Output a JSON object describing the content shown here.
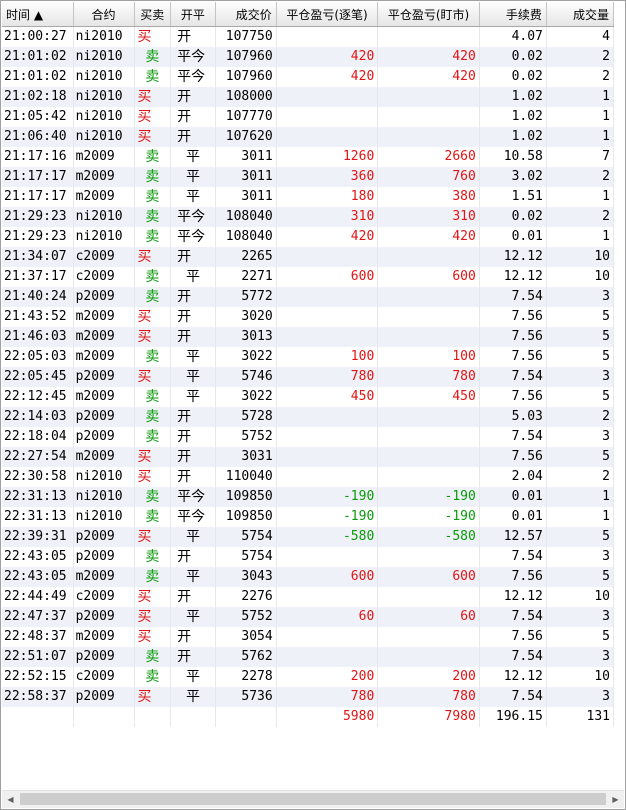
{
  "headers": {
    "time": "时间 ▲",
    "contract": "合约",
    "side": "买卖",
    "open_close": "开平",
    "price": "成交价",
    "pnl_trade": "平仓盈亏(逐笔)",
    "pnl_mark": "平仓盈亏(盯市)",
    "fee": "手续费",
    "volume": "成交量"
  },
  "rows": [
    {
      "time": "21:00:27",
      "contract": "ni2010",
      "side": "买",
      "oc": "开",
      "price": "107750",
      "pnl_trade": "",
      "pnl_mark": "",
      "fee": "4.07",
      "volume": "4"
    },
    {
      "time": "21:01:02",
      "contract": "ni2010",
      "side": "卖",
      "oc": "平今",
      "price": "107960",
      "pnl_trade": "420",
      "pnl_mark": "420",
      "fee": "0.02",
      "volume": "2"
    },
    {
      "time": "21:01:02",
      "contract": "ni2010",
      "side": "卖",
      "oc": "平今",
      "price": "107960",
      "pnl_trade": "420",
      "pnl_mark": "420",
      "fee": "0.02",
      "volume": "2"
    },
    {
      "time": "21:02:18",
      "contract": "ni2010",
      "side": "买",
      "oc": "开",
      "price": "108000",
      "pnl_trade": "",
      "pnl_mark": "",
      "fee": "1.02",
      "volume": "1"
    },
    {
      "time": "21:05:42",
      "contract": "ni2010",
      "side": "买",
      "oc": "开",
      "price": "107770",
      "pnl_trade": "",
      "pnl_mark": "",
      "fee": "1.02",
      "volume": "1"
    },
    {
      "time": "21:06:40",
      "contract": "ni2010",
      "side": "买",
      "oc": "开",
      "price": "107620",
      "pnl_trade": "",
      "pnl_mark": "",
      "fee": "1.02",
      "volume": "1"
    },
    {
      "time": "21:17:16",
      "contract": "m2009",
      "side": "卖",
      "oc": "平",
      "price": "3011",
      "pnl_trade": "1260",
      "pnl_mark": "2660",
      "fee": "10.58",
      "volume": "7"
    },
    {
      "time": "21:17:17",
      "contract": "m2009",
      "side": "卖",
      "oc": "平",
      "price": "3011",
      "pnl_trade": "360",
      "pnl_mark": "760",
      "fee": "3.02",
      "volume": "2"
    },
    {
      "time": "21:17:17",
      "contract": "m2009",
      "side": "卖",
      "oc": "平",
      "price": "3011",
      "pnl_trade": "180",
      "pnl_mark": "380",
      "fee": "1.51",
      "volume": "1"
    },
    {
      "time": "21:29:23",
      "contract": "ni2010",
      "side": "卖",
      "oc": "平今",
      "price": "108040",
      "pnl_trade": "310",
      "pnl_mark": "310",
      "fee": "0.02",
      "volume": "2"
    },
    {
      "time": "21:29:23",
      "contract": "ni2010",
      "side": "卖",
      "oc": "平今",
      "price": "108040",
      "pnl_trade": "420",
      "pnl_mark": "420",
      "fee": "0.01",
      "volume": "1"
    },
    {
      "time": "21:34:07",
      "contract": "c2009",
      "side": "买",
      "oc": "开",
      "price": "2265",
      "pnl_trade": "",
      "pnl_mark": "",
      "fee": "12.12",
      "volume": "10"
    },
    {
      "time": "21:37:17",
      "contract": "c2009",
      "side": "卖",
      "oc": "平",
      "price": "2271",
      "pnl_trade": "600",
      "pnl_mark": "600",
      "fee": "12.12",
      "volume": "10"
    },
    {
      "time": "21:40:24",
      "contract": "p2009",
      "side": "卖",
      "oc": "开",
      "price": "5772",
      "pnl_trade": "",
      "pnl_mark": "",
      "fee": "7.54",
      "volume": "3"
    },
    {
      "time": "21:43:52",
      "contract": "m2009",
      "side": "买",
      "oc": "开",
      "price": "3020",
      "pnl_trade": "",
      "pnl_mark": "",
      "fee": "7.56",
      "volume": "5"
    },
    {
      "time": "21:46:03",
      "contract": "m2009",
      "side": "买",
      "oc": "开",
      "price": "3013",
      "pnl_trade": "",
      "pnl_mark": "",
      "fee": "7.56",
      "volume": "5"
    },
    {
      "time": "22:05:03",
      "contract": "m2009",
      "side": "卖",
      "oc": "平",
      "price": "3022",
      "pnl_trade": "100",
      "pnl_mark": "100",
      "fee": "7.56",
      "volume": "5"
    },
    {
      "time": "22:05:45",
      "contract": "p2009",
      "side": "买",
      "oc": "平",
      "price": "5746",
      "pnl_trade": "780",
      "pnl_mark": "780",
      "fee": "7.54",
      "volume": "3"
    },
    {
      "time": "22:12:45",
      "contract": "m2009",
      "side": "卖",
      "oc": "平",
      "price": "3022",
      "pnl_trade": "450",
      "pnl_mark": "450",
      "fee": "7.56",
      "volume": "5"
    },
    {
      "time": "22:14:03",
      "contract": "p2009",
      "side": "卖",
      "oc": "开",
      "price": "5728",
      "pnl_trade": "",
      "pnl_mark": "",
      "fee": "5.03",
      "volume": "2"
    },
    {
      "time": "22:18:04",
      "contract": "p2009",
      "side": "卖",
      "oc": "开",
      "price": "5752",
      "pnl_trade": "",
      "pnl_mark": "",
      "fee": "7.54",
      "volume": "3"
    },
    {
      "time": "22:27:54",
      "contract": "m2009",
      "side": "买",
      "oc": "开",
      "price": "3031",
      "pnl_trade": "",
      "pnl_mark": "",
      "fee": "7.56",
      "volume": "5"
    },
    {
      "time": "22:30:58",
      "contract": "ni2010",
      "side": "买",
      "oc": "开",
      "price": "110040",
      "pnl_trade": "",
      "pnl_mark": "",
      "fee": "2.04",
      "volume": "2"
    },
    {
      "time": "22:31:13",
      "contract": "ni2010",
      "side": "卖",
      "oc": "平今",
      "price": "109850",
      "pnl_trade": "-190",
      "pnl_mark": "-190",
      "fee": "0.01",
      "volume": "1"
    },
    {
      "time": "22:31:13",
      "contract": "ni2010",
      "side": "卖",
      "oc": "平今",
      "price": "109850",
      "pnl_trade": "-190",
      "pnl_mark": "-190",
      "fee": "0.01",
      "volume": "1"
    },
    {
      "time": "22:39:31",
      "contract": "p2009",
      "side": "买",
      "oc": "平",
      "price": "5754",
      "pnl_trade": "-580",
      "pnl_mark": "-580",
      "fee": "12.57",
      "volume": "5"
    },
    {
      "time": "22:43:05",
      "contract": "p2009",
      "side": "卖",
      "oc": "开",
      "price": "5754",
      "pnl_trade": "",
      "pnl_mark": "",
      "fee": "7.54",
      "volume": "3"
    },
    {
      "time": "22:43:05",
      "contract": "m2009",
      "side": "卖",
      "oc": "平",
      "price": "3043",
      "pnl_trade": "600",
      "pnl_mark": "600",
      "fee": "7.56",
      "volume": "5"
    },
    {
      "time": "22:44:49",
      "contract": "c2009",
      "side": "买",
      "oc": "开",
      "price": "2276",
      "pnl_trade": "",
      "pnl_mark": "",
      "fee": "12.12",
      "volume": "10"
    },
    {
      "time": "22:47:37",
      "contract": "p2009",
      "side": "买",
      "oc": "平",
      "price": "5752",
      "pnl_trade": "60",
      "pnl_mark": "60",
      "fee": "7.54",
      "volume": "3"
    },
    {
      "time": "22:48:37",
      "contract": "m2009",
      "side": "买",
      "oc": "开",
      "price": "3054",
      "pnl_trade": "",
      "pnl_mark": "",
      "fee": "7.56",
      "volume": "5"
    },
    {
      "time": "22:51:07",
      "contract": "p2009",
      "side": "卖",
      "oc": "开",
      "price": "5762",
      "pnl_trade": "",
      "pnl_mark": "",
      "fee": "7.54",
      "volume": "3"
    },
    {
      "time": "22:52:15",
      "contract": "c2009",
      "side": "卖",
      "oc": "平",
      "price": "2278",
      "pnl_trade": "200",
      "pnl_mark": "200",
      "fee": "12.12",
      "volume": "10"
    },
    {
      "time": "22:58:37",
      "contract": "p2009",
      "side": "买",
      "oc": "平",
      "price": "5736",
      "pnl_trade": "780",
      "pnl_mark": "780",
      "fee": "7.54",
      "volume": "3"
    }
  ],
  "totals": {
    "pnl_trade": "5980",
    "pnl_mark": "7980",
    "fee": "196.15",
    "volume": "131"
  },
  "scrollbar": {
    "left_arrow": "◀",
    "right_arrow": "▶"
  },
  "colors": {
    "buy": "#e31414",
    "sell": "#0a9a0a",
    "profit": "#e31414",
    "loss": "#0a9a0a",
    "row_alt": "#eef1f7"
  }
}
